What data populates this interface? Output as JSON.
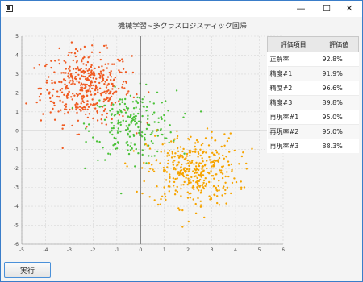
{
  "window": {
    "icon": "window-app-icon",
    "controls": {
      "minimize": "—",
      "maximize": "☐",
      "close": "✕"
    }
  },
  "chart_data": {
    "type": "scatter",
    "title": "機械学習~多クラスロジスティック回帰",
    "xlim": [
      -5,
      6
    ],
    "ylim": [
      -6,
      5
    ],
    "xticks": [
      "-5",
      "-4",
      "-3",
      "-2",
      "-1",
      "0",
      "1",
      "2",
      "3",
      "4",
      "5",
      "6"
    ],
    "yticks": [
      "5",
      "4",
      "3",
      "2",
      "1",
      "0",
      "-1",
      "-2",
      "-3",
      "-4",
      "-5",
      "-6"
    ],
    "grid": true,
    "series": [
      {
        "color": "#f05b22",
        "center": [
          -2.3,
          2.3
        ],
        "spread": [
          0.95,
          0.95
        ],
        "count": 420
      },
      {
        "color": "#4cc23a",
        "center": [
          -0.3,
          0.3
        ],
        "spread": [
          0.9,
          0.9
        ],
        "count": 220
      },
      {
        "color": "#f6a400",
        "center": [
          2.2,
          -2.1
        ],
        "spread": [
          0.95,
          0.95
        ],
        "count": 380
      }
    ]
  },
  "results": {
    "headers": [
      "評価項目",
      "評価値"
    ],
    "rows": [
      [
        "正解率",
        "92.8%"
      ],
      [
        "精度#1",
        "91.9%"
      ],
      [
        "精度#2",
        "96.6%"
      ],
      [
        "精度#3",
        "89.8%"
      ],
      [
        "再現率#1",
        "95.0%"
      ],
      [
        "再現率#2",
        "95.0%"
      ],
      [
        "再現率#3",
        "88.3%"
      ]
    ]
  },
  "run_button": {
    "label": "実行"
  }
}
